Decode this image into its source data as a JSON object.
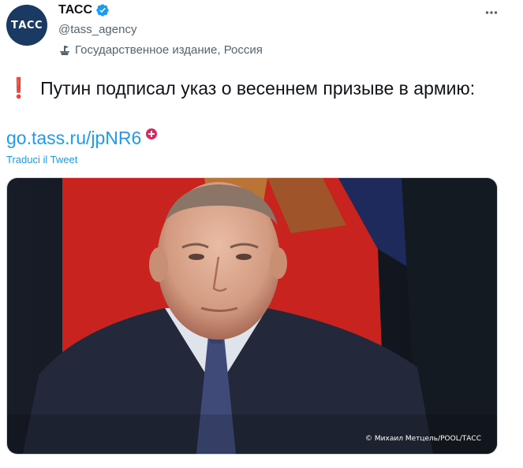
{
  "account": {
    "avatar_text": "ТАСС",
    "display_name": "ТАСС",
    "handle": "@tass_agency",
    "verified_icon": "verified-badge-icon",
    "label_icon": "state-media-icon",
    "label_text": "Государственное издание, Россия"
  },
  "menu": {
    "more_icon": "more-icon"
  },
  "tweet": {
    "exclaim": "❗",
    "text": "Путин подписал указ о весеннем призыве в армию:",
    "link_text": "go.tass.ru/jpNR6",
    "link_badge_icon": "plus-circle-icon",
    "translate_label": "Traduci il Tweet"
  },
  "media": {
    "caption": "© Михаил Метцель/POOL/ТАСС"
  },
  "colors": {
    "accent": "#1d9bf0",
    "avatar_bg": "#1b3a63",
    "exclaim": "#d8262c",
    "flag_red": "#c8231e"
  }
}
